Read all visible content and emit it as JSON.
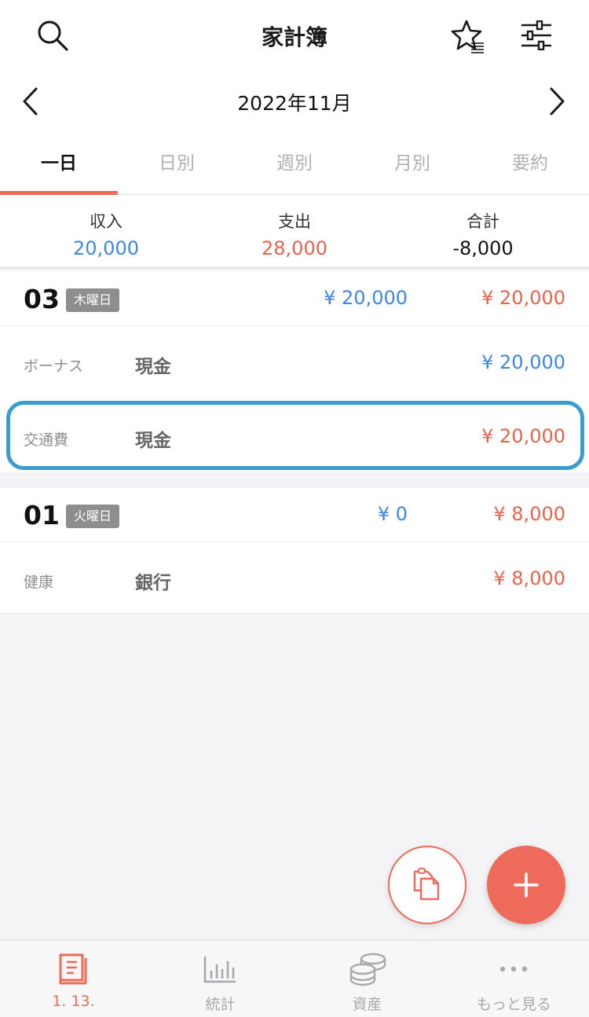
{
  "header": {
    "title": "家計簿",
    "icons": [
      "search-icon",
      "star-list-icon",
      "filter-sliders-icon"
    ]
  },
  "month_nav": {
    "month": "2022年11月",
    "icons": [
      "chevron-left-icon",
      "chevron-right-icon"
    ]
  },
  "tabs": [
    {
      "label": "一日",
      "active": true
    },
    {
      "label": "日別",
      "active": false
    },
    {
      "label": "週別",
      "active": false
    },
    {
      "label": "月別",
      "active": false
    },
    {
      "label": "要約",
      "active": false
    }
  ],
  "summary": {
    "income_label": "収入",
    "income": "20,000",
    "expense_label": "支出",
    "expense": "28,000",
    "total_label": "合計",
    "total": "-8,000"
  },
  "days": [
    {
      "day": "03",
      "weekday": "木曜日",
      "income": "¥ 20,000",
      "expense": "¥ 20,000",
      "entries": [
        {
          "category": "ボーナス",
          "account": "現金",
          "amount": "¥ 20,000",
          "type": "income"
        },
        {
          "category": "交通費",
          "account": "現金",
          "amount": "¥ 20,000",
          "type": "expense",
          "highlighted": true
        }
      ]
    },
    {
      "day": "01",
      "weekday": "火曜日",
      "income": "¥ 0",
      "expense": "¥ 8,000",
      "entries": [
        {
          "category": "健康",
          "account": "銀行",
          "amount": "¥ 8,000",
          "type": "expense"
        }
      ]
    }
  ],
  "fab": {
    "copy_icon": "copy-icon",
    "add_icon": "plus-icon"
  },
  "bottom_nav": [
    {
      "label": "1. 13.",
      "icon": "book-icon",
      "active": true
    },
    {
      "label": "統計",
      "icon": "bar-chart-icon",
      "active": false
    },
    {
      "label": "資産",
      "icon": "coins-icon",
      "active": false
    },
    {
      "label": "もっと見る",
      "icon": "more-dots-icon",
      "active": false
    }
  ],
  "colors": {
    "accent": "#ee6b5c",
    "income": "#3e86e6",
    "expense": "#e9634c",
    "highlight": "#3a9ccf"
  }
}
